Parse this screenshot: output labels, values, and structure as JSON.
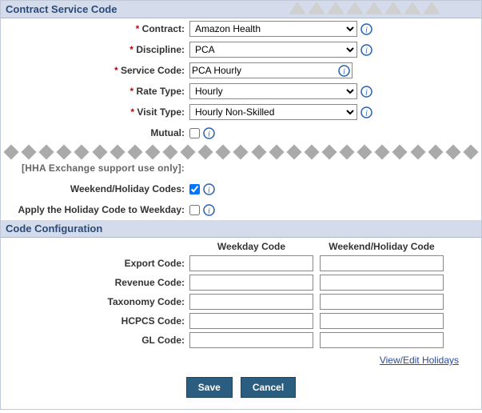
{
  "sections": {
    "contract": "Contract Service Code",
    "config": "Code Configuration"
  },
  "labels": {
    "contract": "Contract:",
    "discipline": "Discipline:",
    "service_code": "Service Code:",
    "rate_type": "Rate Type:",
    "visit_type": "Visit Type:",
    "mutual": "Mutual:",
    "support_only": "[HHA Exchange support use only]:",
    "weekend_codes": "Weekend/Holiday Codes:",
    "apply_holiday": "Apply the Holiday Code to Weekday:",
    "export_code": "Export Code:",
    "revenue_code": "Revenue Code:",
    "taxonomy_code": "Taxonomy Code:",
    "hcpcs_code": "HCPCS Code:",
    "gl_code": "GL Code:"
  },
  "columns": {
    "weekday": "Weekday Code",
    "weekend": "Weekend/Holiday Code"
  },
  "values": {
    "contract": "Amazon Health",
    "discipline": "PCA",
    "service_code": "PCA Hourly",
    "rate_type": "Hourly",
    "visit_type": "Hourly Non-Skilled",
    "mutual": false,
    "weekend_codes": true,
    "apply_holiday": false,
    "codes": {
      "export": {
        "weekday": "",
        "weekend": ""
      },
      "revenue": {
        "weekday": "",
        "weekend": ""
      },
      "taxonomy": {
        "weekday": "",
        "weekend": ""
      },
      "hcpcs": {
        "weekday": "",
        "weekend": ""
      },
      "gl": {
        "weekday": "",
        "weekend": ""
      }
    }
  },
  "links": {
    "view_edit_holidays": "View/Edit Holidays"
  },
  "buttons": {
    "save": "Save",
    "cancel": "Cancel"
  }
}
